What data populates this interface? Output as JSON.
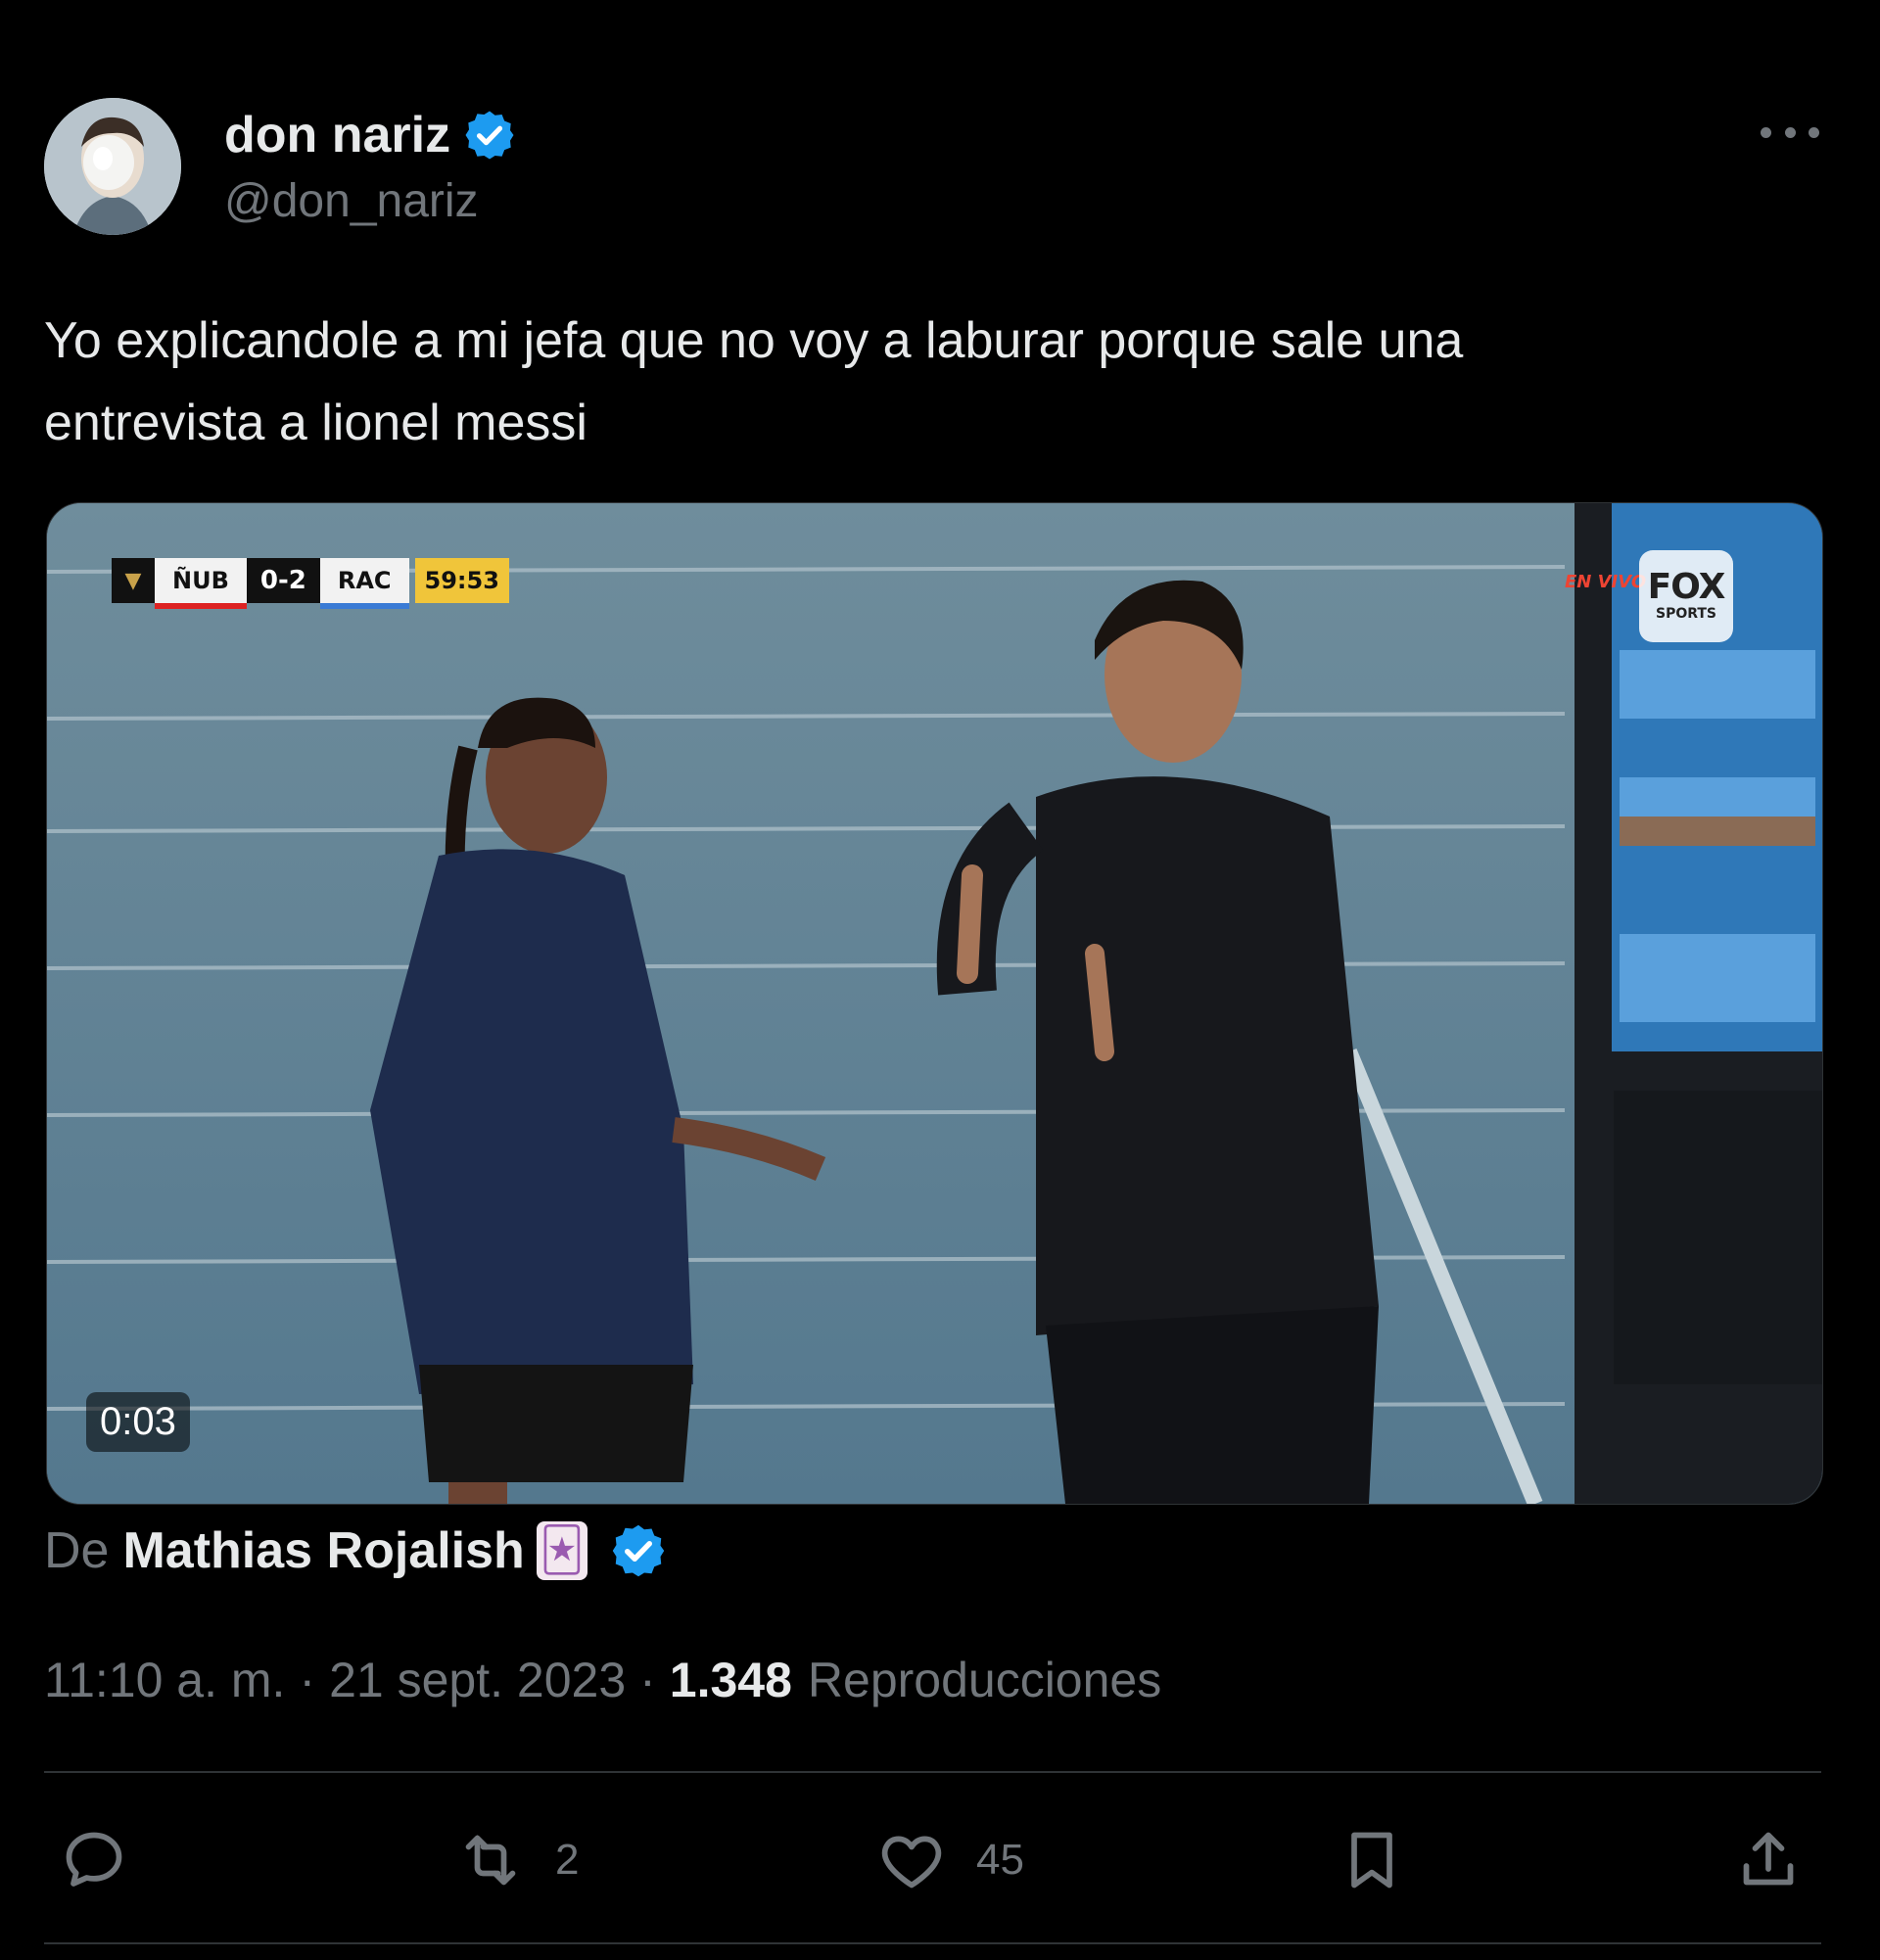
{
  "author": {
    "display_name": "don nariz",
    "handle": "@don_nariz",
    "verified": true
  },
  "tweet": {
    "text": "Yo explicandole a mi jefa que no voy a laburar porque sale una\nentrevista a lionel messi"
  },
  "media": {
    "duration": "0:03",
    "scoreboard": {
      "home": "ÑUB",
      "score": "0-2",
      "away": "RAC",
      "clock": "59:53"
    },
    "live_label": "EN VIVO",
    "broadcaster_line1": "FOX",
    "broadcaster_line2": "SPORTS"
  },
  "attribution": {
    "prefix": "De",
    "name": "Mathias Rojalish",
    "emoji": "🃏",
    "verified": true
  },
  "meta": {
    "time": "11:10 a. m.",
    "separator": "·",
    "date": "21 sept. 2023",
    "views_count": "1.348",
    "views_label": "Reproducciones"
  },
  "actions": {
    "reply_icon": "reply-icon",
    "retweet_icon": "retweet-icon",
    "retweet_count": "2",
    "like_icon": "heart-icon",
    "like_count": "45",
    "bookmark_icon": "bookmark-icon",
    "share_icon": "share-icon"
  },
  "colors": {
    "background": "#000000",
    "text_primary": "#e7e9ea",
    "text_secondary": "#71767b",
    "verified_blue": "#1d9bf0",
    "divider": "#2f3336"
  }
}
